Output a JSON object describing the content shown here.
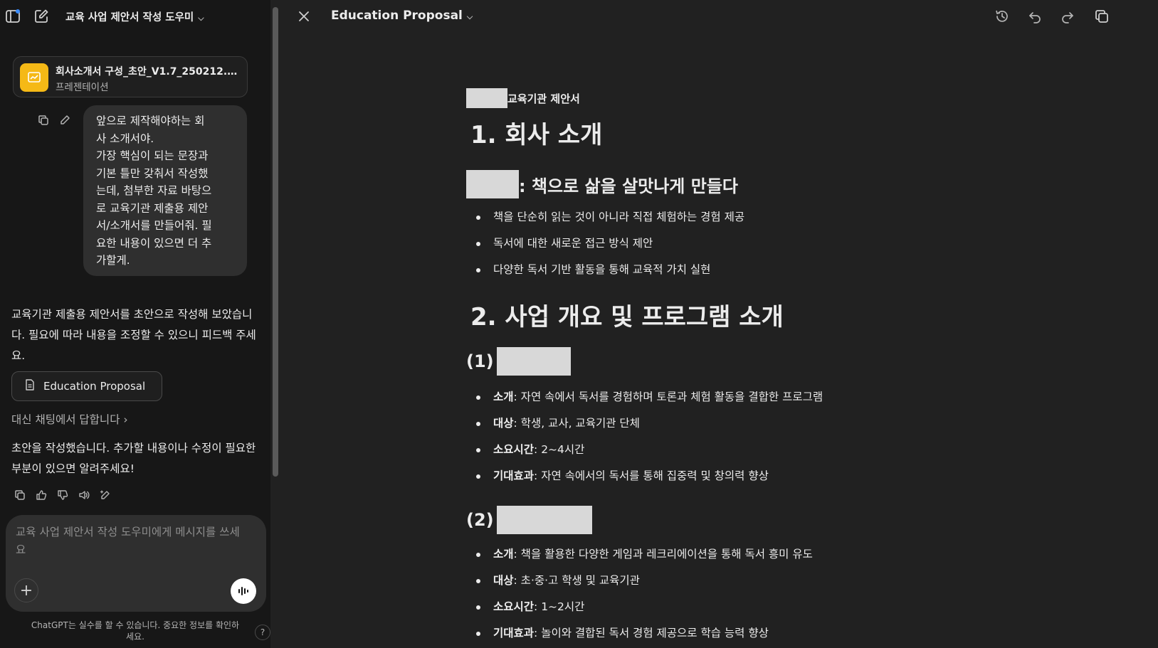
{
  "chat": {
    "gpt_title": "교육 사업 제안서 작성 도우미",
    "attachment": {
      "name": "회사소개서 구성_초안_V1.7_250212.p...",
      "type": "프레젠테이션"
    },
    "user_message": "앞으로 제작해야하는 회\n사 소개서야.\n가장 핵심이 되는 문장과\n기본 틀만 갖춰서 작성했\n는데, 첨부한 자료 바탕으\n로 교육기관 제출용 제안\n서/소개서를 만들어줘. 필\n요한 내용이 있으면 더 추\n가할게.",
    "assistant_message_1": "교육기관 제출용 제안서를 초안으로 작성해 보았습니다. 필요에 따라 내용을 조정할 수 있으니 피드백 주세요.",
    "canvas_button_label": "Education Proposal",
    "reply_in_chat": "대신 채팅에서 답합니다",
    "assistant_message_2": "초안을 작성했습니다. 추가할 내용이나 수정이 필요한 부분이 있으면 알려주세요!",
    "composer_placeholder": "교육 사업 제안서 작성 도우미에게 메시지를 쓰세요",
    "disclaimer": "ChatGPT는 실수를 할 수 있습니다. 중요한 정보를 확인하세요.",
    "help": "?"
  },
  "canvas": {
    "title": "Education Proposal",
    "kicker": "교육기관 제안서",
    "section1": {
      "heading": "1. 회사 소개",
      "subheading": ": 책으로 삶을 살맛나게 만들다",
      "bullets": [
        "책을 단순히 읽는 것이 아니라 직접 체험하는 경험 제공",
        "독서에 대한 새로운 접근 방식 제안",
        "다양한 독서 기반 활동을 통해 교육적 가치 실현"
      ]
    },
    "section2": {
      "heading": "2. 사업 개요 및 프로그램 소개",
      "programs": [
        {
          "number": "(1)",
          "items": [
            {
              "label": "소개",
              "text": ": 자연 속에서 독서를 경험하며 토론과 체험 활동을 결합한 프로그램"
            },
            {
              "label": "대상",
              "text": ": 학생, 교사, 교육기관 단체"
            },
            {
              "label": "소요시간",
              "text": ": 2~4시간"
            },
            {
              "label": "기대효과",
              "text": ": 자연 속에서의 독서를 통해 집중력 및 창의력 향상"
            }
          ]
        },
        {
          "number": "(2)",
          "items": [
            {
              "label": "소개",
              "text": ": 책을 활용한 다양한 게임과 레크리에이션을 통해 독서 흥미 유도"
            },
            {
              "label": "대상",
              "text": ": 초·중·고 학생 및 교육기관"
            },
            {
              "label": "소요시간",
              "text": ": 1~2시간"
            },
            {
              "label": "기대효과",
              "text": ": 놀이와 결합된 독서 경험 제공으로 학습 능력 향상"
            }
          ]
        }
      ]
    }
  },
  "colors": {
    "sidebar_bg": "#171717",
    "canvas_bg": "#212121",
    "bubble_bg": "#2f2f2f",
    "file_icon": "#f5b916",
    "redaction": "#d8d8d8"
  }
}
